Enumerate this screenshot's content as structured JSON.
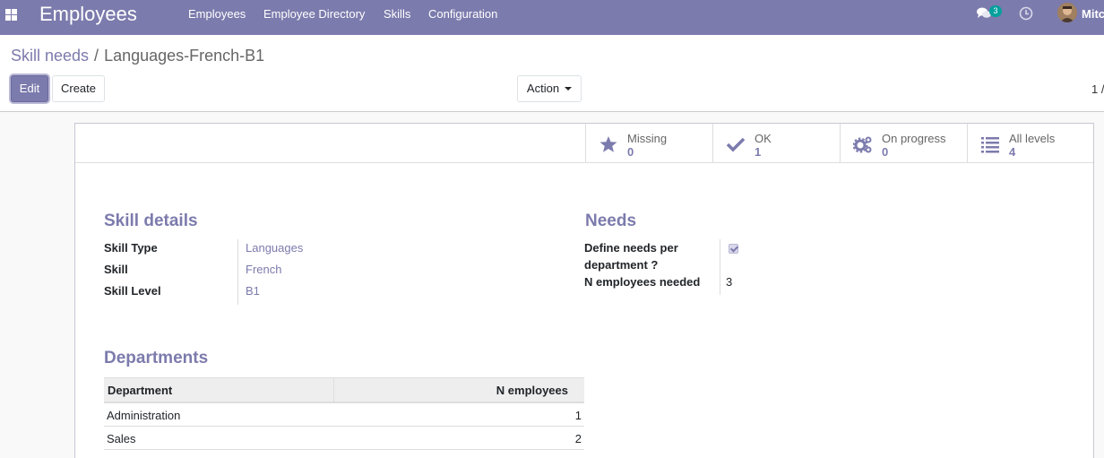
{
  "navbar": {
    "app_title": "Employees",
    "menu": [
      "Employees",
      "Employee Directory",
      "Skills",
      "Configuration"
    ],
    "chat_count": "3",
    "user_name": "Mitc"
  },
  "breadcrumb": {
    "parent": "Skill needs",
    "separator": "/",
    "current": "Languages-French-B1"
  },
  "buttons": {
    "edit": "Edit",
    "create": "Create",
    "action": "Action"
  },
  "pager": "1 /",
  "stat_buttons": [
    {
      "icon": "star-icon",
      "label": "Missing",
      "value": "0"
    },
    {
      "icon": "check-icon",
      "label": "OK",
      "value": "1"
    },
    {
      "icon": "gears-icon",
      "label": "On progress",
      "value": "0"
    },
    {
      "icon": "list-icon",
      "label": "All levels",
      "value": "4"
    }
  ],
  "skill_details": {
    "title": "Skill details",
    "fields": [
      {
        "label": "Skill Type",
        "value": "Languages"
      },
      {
        "label": "Skill",
        "value": "French"
      },
      {
        "label": "Skill Level",
        "value": "B1"
      }
    ]
  },
  "needs": {
    "title": "Needs",
    "define_label_line1": "Define needs per",
    "define_label_line2": "department ?",
    "define_checked": true,
    "n_label": "N employees needed",
    "n_value": "3"
  },
  "departments": {
    "title": "Departments",
    "columns": [
      "Department",
      "N employees"
    ],
    "rows": [
      {
        "department": "Administration",
        "n": "1"
      },
      {
        "department": "Sales",
        "n": "2"
      }
    ]
  },
  "colors": {
    "brand": "#7c7bad",
    "badge": "#00a09d"
  }
}
